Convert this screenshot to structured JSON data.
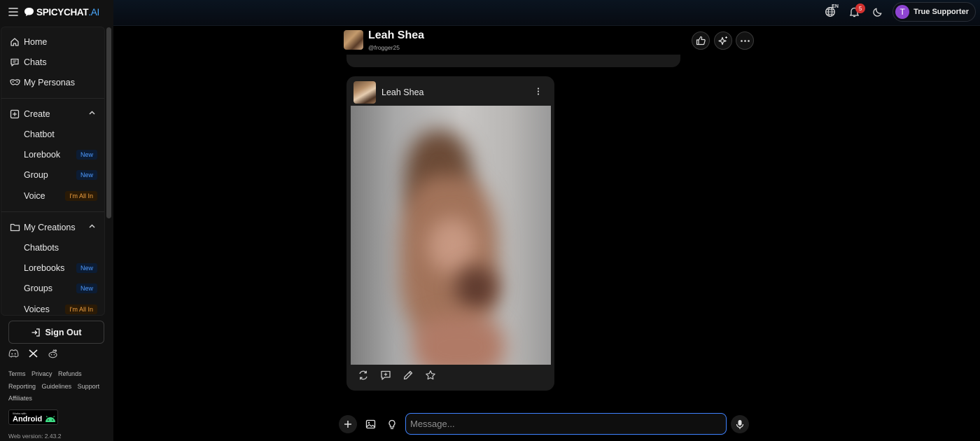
{
  "brand": {
    "name": "SPICYCHAT",
    "suffix": ".AI"
  },
  "topbar": {
    "language_code": "EN",
    "notification_count": "5",
    "user_initial": "T",
    "user_name": "True Supporter",
    "icons": [
      "globe-icon",
      "bell-icon",
      "moon-icon"
    ]
  },
  "sidebar": {
    "main_items": [
      {
        "label": "Home",
        "icon": "home-icon"
      },
      {
        "label": "Chats",
        "icon": "chat-icon"
      },
      {
        "label": "My Personas",
        "icon": "mask-icon"
      }
    ],
    "create": {
      "label": "Create",
      "items": [
        {
          "label": "Chatbot",
          "tag": ""
        },
        {
          "label": "Lorebook",
          "tag": "New"
        },
        {
          "label": "Group",
          "tag": "New"
        },
        {
          "label": "Voice",
          "tag": "I'm All In"
        }
      ]
    },
    "my_creations": {
      "label": "My Creations",
      "items": [
        {
          "label": "Chatbots",
          "tag": ""
        },
        {
          "label": "Lorebooks",
          "tag": "New"
        },
        {
          "label": "Groups",
          "tag": "New"
        },
        {
          "label": "Voices",
          "tag": "I'm All In"
        }
      ]
    },
    "sign_out": "Sign Out",
    "footer_links": [
      "Terms",
      "Privacy",
      "Refunds",
      "Reporting",
      "Guidelines",
      "Support",
      "Affiliates"
    ],
    "android_badge": {
      "small": "Works with",
      "word": "Android"
    },
    "web_version": "Web version: 2.43.2"
  },
  "chat": {
    "character_name": "Leah Shea",
    "character_handle": "@frogger25",
    "header_actions": [
      "like-icon",
      "sparkle-icon",
      "more-icon"
    ],
    "message": {
      "author": "Leah Shea",
      "image_blurred": true,
      "actions": [
        "regenerate-icon",
        "reply-icon",
        "edit-icon",
        "star-icon"
      ]
    }
  },
  "composer": {
    "placeholder": "Message...",
    "value": ""
  },
  "colors": {
    "accent_blue": "#3f82ff",
    "new_tag": "#4f9bff",
    "premium_tag": "#f0a040",
    "notification": "#d3312f",
    "avatar_purple": "#8e44d1"
  }
}
